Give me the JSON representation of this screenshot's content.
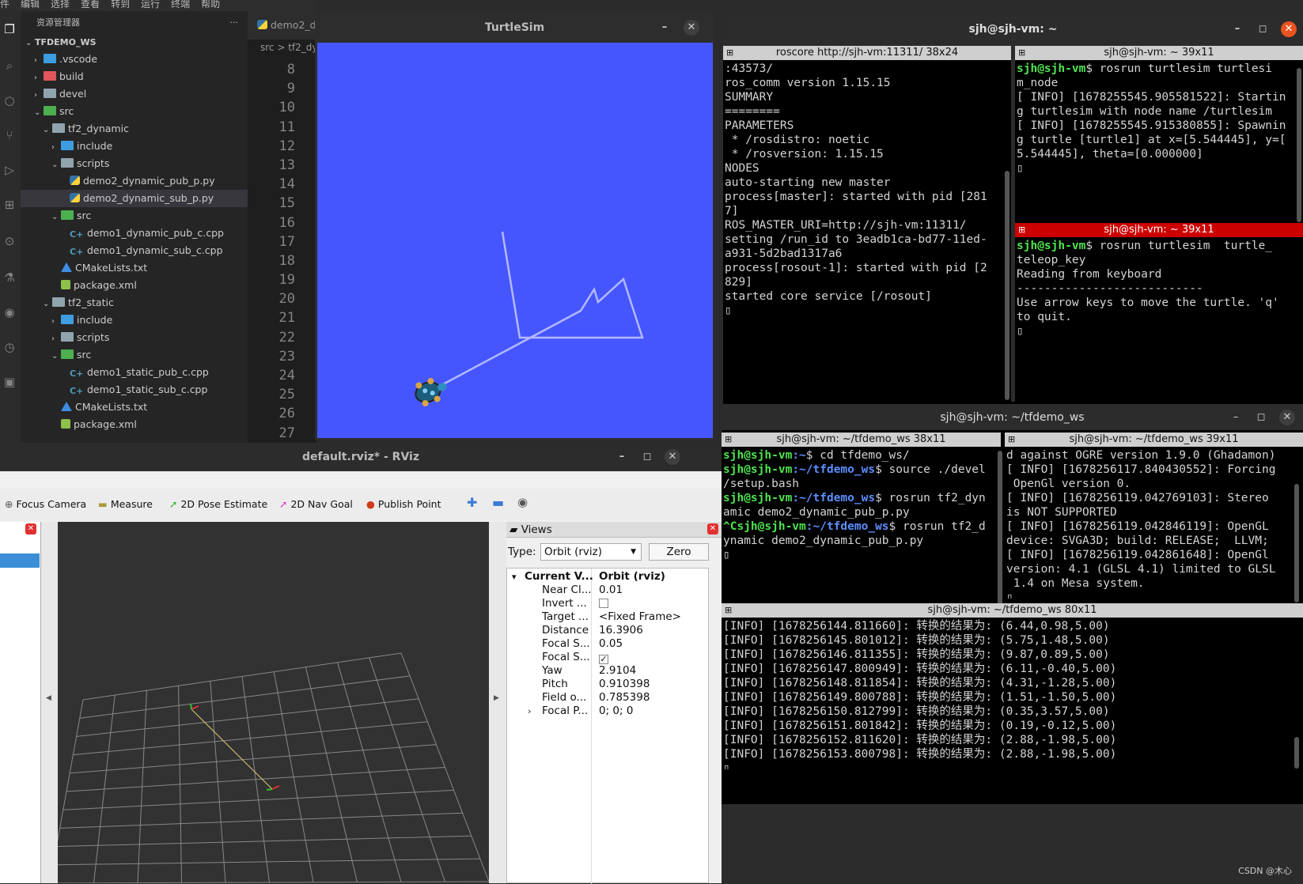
{
  "vscode": {
    "menu": [
      "件",
      "编辑",
      "选择",
      "查看",
      "转到",
      "运行",
      "终端",
      "帮助"
    ],
    "explorer_title": "资源管理器",
    "more": "···",
    "tab_label": "demo2_d",
    "breadcrumb": "src > tf2_dy",
    "tree": [
      {
        "label": "TFDEMO_WS",
        "depth": 0,
        "chev": "⌄",
        "icon": "none",
        "bold": true
      },
      {
        "label": ".vscode",
        "depth": 1,
        "chev": "›",
        "icon": "folder-vscode"
      },
      {
        "label": "build",
        "depth": 1,
        "chev": "›",
        "icon": "folder-build"
      },
      {
        "label": "devel",
        "depth": 1,
        "chev": "›",
        "icon": "folder"
      },
      {
        "label": "src",
        "depth": 1,
        "chev": "⌄",
        "icon": "folder-src"
      },
      {
        "label": "tf2_dynamic",
        "depth": 2,
        "chev": "⌄",
        "icon": "folder"
      },
      {
        "label": "include",
        "depth": 3,
        "chev": "›",
        "icon": "folder-include"
      },
      {
        "label": "scripts",
        "depth": 3,
        "chev": "⌄",
        "icon": "folder"
      },
      {
        "label": "demo2_dynamic_pub_p.py",
        "depth": 4,
        "chev": "",
        "icon": "python"
      },
      {
        "label": "demo2_dynamic_sub_p.py",
        "depth": 4,
        "chev": "",
        "icon": "python",
        "selected": true
      },
      {
        "label": "src",
        "depth": 3,
        "chev": "⌄",
        "icon": "folder-src"
      },
      {
        "label": "demo1_dynamic_pub_c.cpp",
        "depth": 4,
        "chev": "",
        "icon": "cpp"
      },
      {
        "label": "demo1_dynamic_sub_c.cpp",
        "depth": 4,
        "chev": "",
        "icon": "cpp"
      },
      {
        "label": "CMakeLists.txt",
        "depth": 3,
        "chev": "",
        "icon": "cmake"
      },
      {
        "label": "package.xml",
        "depth": 3,
        "chev": "",
        "icon": "xml"
      },
      {
        "label": "tf2_static",
        "depth": 2,
        "chev": "⌄",
        "icon": "folder"
      },
      {
        "label": "include",
        "depth": 3,
        "chev": "›",
        "icon": "folder-include"
      },
      {
        "label": "scripts",
        "depth": 3,
        "chev": "›",
        "icon": "folder"
      },
      {
        "label": "src",
        "depth": 3,
        "chev": "⌄",
        "icon": "folder-src"
      },
      {
        "label": "demo1_static_pub_c.cpp",
        "depth": 4,
        "chev": "",
        "icon": "cpp"
      },
      {
        "label": "demo1_static_sub_c.cpp",
        "depth": 4,
        "chev": "",
        "icon": "cpp"
      },
      {
        "label": "CMakeLists.txt",
        "depth": 3,
        "chev": "",
        "icon": "cmake"
      },
      {
        "label": "package.xml",
        "depth": 3,
        "chev": "",
        "icon": "xml"
      }
    ],
    "line_numbers": [
      "8",
      "9",
      "10",
      "11",
      "12",
      "13",
      "14",
      "15",
      "16",
      "17",
      "18",
      "19",
      "20",
      "21",
      "22",
      "23",
      "24",
      "25",
      "26",
      "27"
    ]
  },
  "turtlesim": {
    "title": "TurtleSim",
    "bg_color": "#4556ff",
    "minimize": "–",
    "close": "✕"
  },
  "term_top": {
    "title": "sjh@sjh-vm: ~",
    "left_pane_title": "roscore http://sjh-vm:11311/ 38x24",
    "right_top_title": "sjh@sjh-vm: ~ 39x11",
    "right_bottom_title": "sjh@sjh-vm: ~ 39x11",
    "roscore_lines": [
      ":43573/",
      "ros_comm version 1.15.15",
      "",
      "",
      "SUMMARY",
      "========",
      "",
      "PARAMETERS",
      " * /rosdistro: noetic",
      " * /rosversion: 1.15.15",
      "",
      "NODES",
      "",
      "auto-starting new master",
      "process[master]: started with pid [281",
      "7]",
      "ROS_MASTER_URI=http://sjh-vm:11311/",
      "",
      "setting /run_id to 3eadb1ca-bd77-11ed-",
      "a931-5d2bad1317a6",
      "process[rosout-1]: started with pid [2",
      "829]",
      "started core service [/rosout]"
    ],
    "turtlesim_prompt": "sjh@sjh-vm",
    "turtlesim_cmd": "$ rosrun turtlesim turtlesi",
    "turtlesim_lines": [
      "m_node",
      "[ INFO] [1678255545.905581522]: Startin",
      "g turtlesim with node name /turtlesim",
      "[ INFO] [1678255545.915380855]: Spawnin",
      "g turtle [turtle1] at x=[5.544445], y=[",
      "5.544445], theta=[0.000000]"
    ],
    "teleop_prompt": "sjh@sjh-vm",
    "teleop_cmd": "$ rosrun turtlesim  turtle_",
    "teleop_lines": [
      "teleop_key",
      "Reading from keyboard",
      "---------------------------",
      "Use arrow keys to move the turtle. 'q'",
      "to quit."
    ]
  },
  "term_bottom": {
    "title": "sjh@sjh-vm: ~/tfdemo_ws",
    "left_pane_title": "sjh@sjh-vm: ~/tfdemo_ws 38x11",
    "right_pane_title": "sjh@sjh-vm: ~/tfdemo_ws 39x11",
    "bottom_pane_title": "sjh@sjh-vm: ~/tfdemo_ws 80x11",
    "left_lines": [
      {
        "user": "sjh@sjh-vm",
        "path": ":~",
        "rest": "$ cd tfdemo_ws/"
      },
      {
        "user": "sjh@sjh-vm",
        "path": ":~/tfdemo_ws",
        "rest": "$ source ./devel"
      },
      {
        "user": "",
        "path": "",
        "rest": "/setup.bash"
      },
      {
        "user": "sjh@sjh-vm",
        "path": ":~/tfdemo_ws",
        "rest": "$ rosrun tf2_dyn"
      },
      {
        "user": "",
        "path": "",
        "rest": "amic demo2_dynamic_pub_p.py"
      },
      {
        "user": "^Csjh@sjh-vm",
        "path": ":~/tfdemo_ws",
        "rest": "$ rosrun tf2_d"
      },
      {
        "user": "",
        "path": "",
        "rest": "ynamic demo2_dynamic_pub_p.py"
      }
    ],
    "right_lines": [
      "d against OGRE version 1.9.0 (Ghadamon)",
      "[ INFO] [1678256117.840430552]: Forcing",
      " OpenGl version 0.",
      "[ INFO] [1678256119.042769103]: Stereo",
      "is NOT SUPPORTED",
      "[ INFO] [1678256119.042846119]: OpenGL",
      "device: SVGA3D; build: RELEASE;  LLVM;",
      "[ INFO] [1678256119.042861648]: OpenGl",
      "version: 4.1 (GLSL 4.1) limited to GLSL",
      " 1.4 on Mesa system."
    ],
    "log_lines": [
      "[INFO] [1678256144.811660]: 转换的结果为: (6.44,0.98,5.00)",
      "[INFO] [1678256145.801012]: 转换的结果为: (5.75,1.48,5.00)",
      "[INFO] [1678256146.811355]: 转换的结果为: (9.87,0.89,5.00)",
      "[INFO] [1678256147.800949]: 转换的结果为: (6.11,-0.40,5.00)",
      "[INFO] [1678256148.811854]: 转换的结果为: (4.31,-1.28,5.00)",
      "[INFO] [1678256149.800788]: 转换的结果为: (1.51,-1.50,5.00)",
      "[INFO] [1678256150.812799]: 转换的结果为: (0.35,3.57,5.00)",
      "[INFO] [1678256151.801842]: 转换的结果为: (0.19,-0.12,5.00)",
      "[INFO] [1678256152.811620]: 转换的结果为: (2.88,-1.98,5.00)",
      "[INFO] [1678256153.800798]: 转换的结果为: (2.88,-1.98,5.00)"
    ]
  },
  "rviz": {
    "title": "default.rviz* - RViz",
    "tools": [
      {
        "label": "Focus Camera",
        "icon": "focus-camera-icon",
        "glyph": "⊕",
        "color": "#555"
      },
      {
        "label": "Measure",
        "icon": "ruler-icon",
        "glyph": "▬",
        "color": "#a89a3a"
      },
      {
        "label": "2D Pose Estimate",
        "icon": "pose-arrow-icon",
        "glyph": "➚",
        "color": "#2bb52b"
      },
      {
        "label": "2D Nav Goal",
        "icon": "goal-arrow-icon",
        "glyph": "➚",
        "color": "#d63ad6"
      },
      {
        "label": "Publish Point",
        "icon": "pin-icon",
        "glyph": "●",
        "color": "#d03b1c"
      }
    ],
    "views_panel_title": "Views",
    "type_label": "Type:",
    "type_value": "Orbit (rviz)",
    "zero_button": "Zero",
    "props": [
      {
        "k": "Current V...",
        "v": "Orbit (rviz)",
        "bold": true,
        "arrow": "▾"
      },
      {
        "k": "Near Cl...",
        "v": "0.01"
      },
      {
        "k": "Invert ...",
        "v": "",
        "check": "unchecked"
      },
      {
        "k": "Target ...",
        "v": "<Fixed Frame>"
      },
      {
        "k": "Distance",
        "v": "16.3906"
      },
      {
        "k": "Focal S...",
        "v": "0.05"
      },
      {
        "k": "Focal S...",
        "v": "",
        "check": "checked"
      },
      {
        "k": "Yaw",
        "v": "2.9104"
      },
      {
        "k": "Pitch",
        "v": "0.910398"
      },
      {
        "k": "Field o...",
        "v": "0.785398"
      },
      {
        "k": "Focal P...",
        "v": "0; 0; 0",
        "arrow": "›"
      }
    ]
  },
  "watermark": "CSDN @木心"
}
